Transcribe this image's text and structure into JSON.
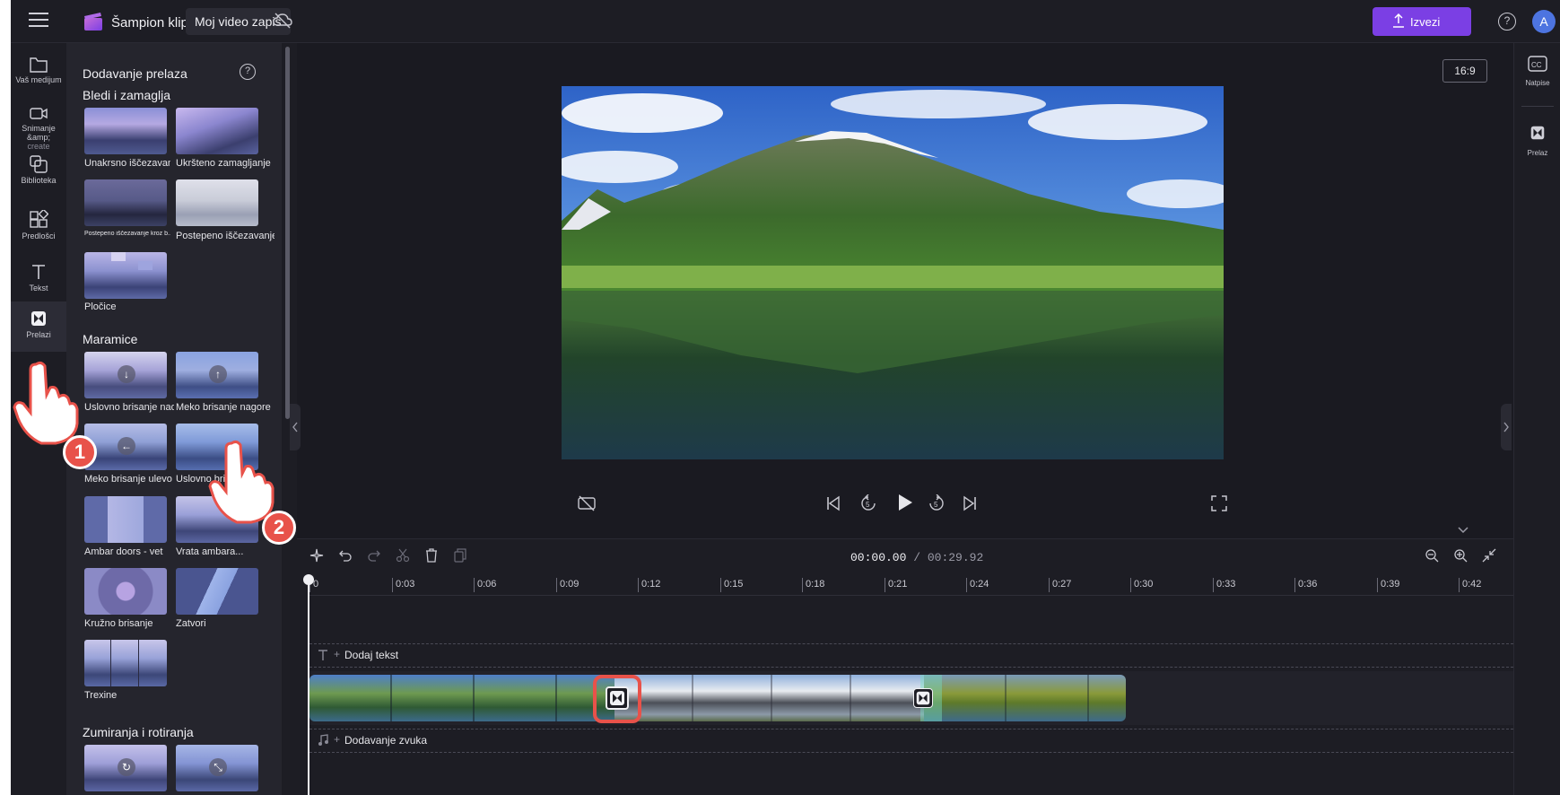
{
  "header": {
    "app_name": "Šampion klipa",
    "project_name": "Moj video zapis",
    "export_label": "Izvezi",
    "help": "?",
    "avatar_initial": "A"
  },
  "leftnav": {
    "items": [
      {
        "label": "Vaš medijum",
        "icon": "folder-icon"
      },
      {
        "label": "Snimanje &amp;",
        "label2": "create",
        "icon": "camera-icon"
      },
      {
        "label": "Biblioteka",
        "icon": "library-icon"
      },
      {
        "label": "Predlošci",
        "icon": "templates-icon"
      },
      {
        "label": "Tekst",
        "icon": "text-icon"
      },
      {
        "label": "Prelazi",
        "icon": "transitions-icon",
        "active": true
      }
    ]
  },
  "panel": {
    "title": "Dodavanje prelaza",
    "help": "?",
    "sections": [
      {
        "title": "Bledi i zamaglja"
      },
      {
        "title": "Maramice"
      },
      {
        "title": "Zumiranja i rotiranja"
      }
    ],
    "items": [
      {
        "label": "Unakrsno iščezavanje"
      },
      {
        "label": "Ukršteno zamagljanje"
      },
      {
        "label": "Postepeno iščezavanje kroz b..."
      },
      {
        "label": "Postepeno iščezavanje"
      },
      {
        "label": "Pločice"
      },
      {
        "label": "Uslovno brisanje nadole"
      },
      {
        "label": "Meko brisanje nagore"
      },
      {
        "label": "Meko brisanje ulevo"
      },
      {
        "label": "Uslovno brisa..."
      },
      {
        "label": "Ambar doors - vet"
      },
      {
        "label": "Vrata ambara..."
      },
      {
        "label": "Kružno brisanje"
      },
      {
        "label": "Zatvori"
      },
      {
        "label": "Trexine"
      }
    ]
  },
  "preview": {
    "aspect_ratio": "16:9"
  },
  "rightrail": {
    "captions_label": "Natpise",
    "captions_icon": "CC",
    "transition_label": "Prelaz"
  },
  "timeline": {
    "current_time": "00:00.00",
    "total_time": "/ 00:29.92",
    "ticks": [
      "0",
      "0:03",
      "0:06",
      "0:09",
      "0:12",
      "0:15",
      "0:18",
      "0:21",
      "0:24",
      "0:27",
      "0:30",
      "0:33",
      "0:36",
      "0:39",
      "0:42"
    ],
    "add_text_label": "Dodaj tekst",
    "add_audio_label": "Dodavanje zvuka"
  },
  "annotations": {
    "step1": "1",
    "step2": "2"
  },
  "colors": {
    "accent": "#7b3fe4",
    "highlight": "#e8524a",
    "background": "#1d1d24",
    "panel": "#25252d"
  }
}
